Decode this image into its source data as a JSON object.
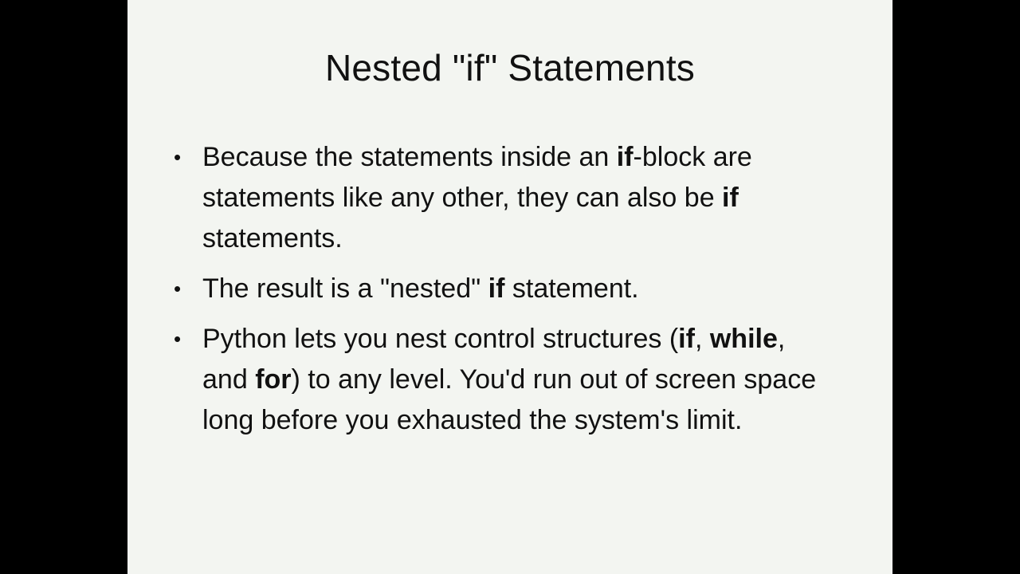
{
  "slide": {
    "title": "Nested \"if\" Statements",
    "bullets": [
      {
        "segments": [
          {
            "text": "Because the statements inside an ",
            "bold": false
          },
          {
            "text": "if",
            "bold": true
          },
          {
            "text": "-block are statements like any other, they can also be ",
            "bold": false
          },
          {
            "text": "if",
            "bold": true
          },
          {
            "text": " statements.",
            "bold": false
          }
        ]
      },
      {
        "segments": [
          {
            "text": "The result is a \"nested\" ",
            "bold": false
          },
          {
            "text": "if",
            "bold": true
          },
          {
            "text": " statement.",
            "bold": false
          }
        ]
      },
      {
        "segments": [
          {
            "text": "Python lets you nest control structures (",
            "bold": false
          },
          {
            "text": "if",
            "bold": true
          },
          {
            "text": ", ",
            "bold": false
          },
          {
            "text": "while",
            "bold": true
          },
          {
            "text": ", and ",
            "bold": false
          },
          {
            "text": "for",
            "bold": true
          },
          {
            "text": ") to any level. You'd run out of screen space long before you exhausted the system's limit.",
            "bold": false
          }
        ]
      }
    ]
  },
  "colors": {
    "slide_background": "#f3f5f1",
    "letterbox": "#000000",
    "text": "#111111"
  }
}
